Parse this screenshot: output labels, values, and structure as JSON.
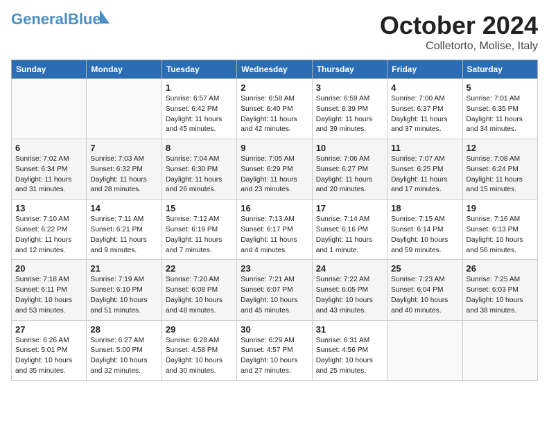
{
  "header": {
    "logo_line1": "General",
    "logo_line2": "Blue",
    "month": "October 2024",
    "location": "Colletorto, Molise, Italy"
  },
  "weekdays": [
    "Sunday",
    "Monday",
    "Tuesday",
    "Wednesday",
    "Thursday",
    "Friday",
    "Saturday"
  ],
  "weeks": [
    [
      {
        "day": "",
        "info": ""
      },
      {
        "day": "",
        "info": ""
      },
      {
        "day": "1",
        "info": "Sunrise: 6:57 AM\nSunset: 6:42 PM\nDaylight: 11 hours and 45 minutes."
      },
      {
        "day": "2",
        "info": "Sunrise: 6:58 AM\nSunset: 6:40 PM\nDaylight: 11 hours and 42 minutes."
      },
      {
        "day": "3",
        "info": "Sunrise: 6:59 AM\nSunset: 6:39 PM\nDaylight: 11 hours and 39 minutes."
      },
      {
        "day": "4",
        "info": "Sunrise: 7:00 AM\nSunset: 6:37 PM\nDaylight: 11 hours and 37 minutes."
      },
      {
        "day": "5",
        "info": "Sunrise: 7:01 AM\nSunset: 6:35 PM\nDaylight: 11 hours and 34 minutes."
      }
    ],
    [
      {
        "day": "6",
        "info": "Sunrise: 7:02 AM\nSunset: 6:34 PM\nDaylight: 11 hours and 31 minutes."
      },
      {
        "day": "7",
        "info": "Sunrise: 7:03 AM\nSunset: 6:32 PM\nDaylight: 11 hours and 28 minutes."
      },
      {
        "day": "8",
        "info": "Sunrise: 7:04 AM\nSunset: 6:30 PM\nDaylight: 11 hours and 26 minutes."
      },
      {
        "day": "9",
        "info": "Sunrise: 7:05 AM\nSunset: 6:29 PM\nDaylight: 11 hours and 23 minutes."
      },
      {
        "day": "10",
        "info": "Sunrise: 7:06 AM\nSunset: 6:27 PM\nDaylight: 11 hours and 20 minutes."
      },
      {
        "day": "11",
        "info": "Sunrise: 7:07 AM\nSunset: 6:25 PM\nDaylight: 11 hours and 17 minutes."
      },
      {
        "day": "12",
        "info": "Sunrise: 7:08 AM\nSunset: 6:24 PM\nDaylight: 11 hours and 15 minutes."
      }
    ],
    [
      {
        "day": "13",
        "info": "Sunrise: 7:10 AM\nSunset: 6:22 PM\nDaylight: 11 hours and 12 minutes."
      },
      {
        "day": "14",
        "info": "Sunrise: 7:11 AM\nSunset: 6:21 PM\nDaylight: 11 hours and 9 minutes."
      },
      {
        "day": "15",
        "info": "Sunrise: 7:12 AM\nSunset: 6:19 PM\nDaylight: 11 hours and 7 minutes."
      },
      {
        "day": "16",
        "info": "Sunrise: 7:13 AM\nSunset: 6:17 PM\nDaylight: 11 hours and 4 minutes."
      },
      {
        "day": "17",
        "info": "Sunrise: 7:14 AM\nSunset: 6:16 PM\nDaylight: 11 hours and 1 minute."
      },
      {
        "day": "18",
        "info": "Sunrise: 7:15 AM\nSunset: 6:14 PM\nDaylight: 10 hours and 59 minutes."
      },
      {
        "day": "19",
        "info": "Sunrise: 7:16 AM\nSunset: 6:13 PM\nDaylight: 10 hours and 56 minutes."
      }
    ],
    [
      {
        "day": "20",
        "info": "Sunrise: 7:18 AM\nSunset: 6:11 PM\nDaylight: 10 hours and 53 minutes."
      },
      {
        "day": "21",
        "info": "Sunrise: 7:19 AM\nSunset: 6:10 PM\nDaylight: 10 hours and 51 minutes."
      },
      {
        "day": "22",
        "info": "Sunrise: 7:20 AM\nSunset: 6:08 PM\nDaylight: 10 hours and 48 minutes."
      },
      {
        "day": "23",
        "info": "Sunrise: 7:21 AM\nSunset: 6:07 PM\nDaylight: 10 hours and 45 minutes."
      },
      {
        "day": "24",
        "info": "Sunrise: 7:22 AM\nSunset: 6:05 PM\nDaylight: 10 hours and 43 minutes."
      },
      {
        "day": "25",
        "info": "Sunrise: 7:23 AM\nSunset: 6:04 PM\nDaylight: 10 hours and 40 minutes."
      },
      {
        "day": "26",
        "info": "Sunrise: 7:25 AM\nSunset: 6:03 PM\nDaylight: 10 hours and 38 minutes."
      }
    ],
    [
      {
        "day": "27",
        "info": "Sunrise: 6:26 AM\nSunset: 5:01 PM\nDaylight: 10 hours and 35 minutes."
      },
      {
        "day": "28",
        "info": "Sunrise: 6:27 AM\nSunset: 5:00 PM\nDaylight: 10 hours and 32 minutes."
      },
      {
        "day": "29",
        "info": "Sunrise: 6:28 AM\nSunset: 4:58 PM\nDaylight: 10 hours and 30 minutes."
      },
      {
        "day": "30",
        "info": "Sunrise: 6:29 AM\nSunset: 4:57 PM\nDaylight: 10 hours and 27 minutes."
      },
      {
        "day": "31",
        "info": "Sunrise: 6:31 AM\nSunset: 4:56 PM\nDaylight: 10 hours and 25 minutes."
      },
      {
        "day": "",
        "info": ""
      },
      {
        "day": "",
        "info": ""
      }
    ]
  ]
}
